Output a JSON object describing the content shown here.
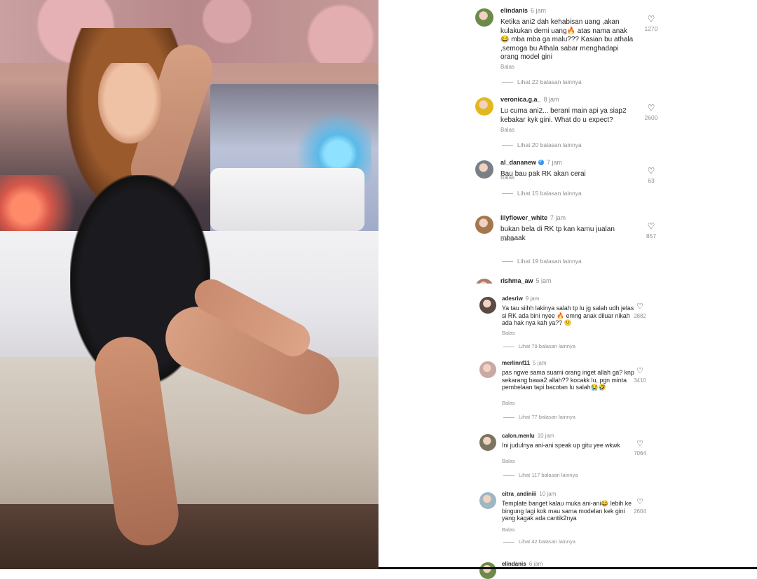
{
  "photo": {
    "alt": ""
  },
  "comments_top": [
    {
      "username": "elindanis",
      "time": "6 jam",
      "verified": false,
      "text": "Ketika ani2 dah kehabisan uang ,akan kulakukan demi uang🔥 atas nama anak 😂 mba mba ga malu??? Kasian bu athala ,semoga bu Athala sabar menghadapi orang model gini",
      "reply": "Balas",
      "likes": "1270",
      "more": "Lihat 22 balasan lainnya",
      "avatar_color": "#6d8a4a"
    },
    {
      "username": "veronica.g.a_",
      "time": "8 jam",
      "verified": false,
      "text": "Lu cuma ani2... berani main api ya siap2 kebakar kyk gini. What do u expect?",
      "reply": "Balas",
      "likes": "2600",
      "more": "Lihat 20 balasan lainnya",
      "avatar_color": "#e2b81f"
    },
    {
      "username": "al_dananew",
      "time": "7 jam",
      "verified": true,
      "text": "Bau bau pak RK akan cerai",
      "reply": "Balas",
      "likes": "63",
      "more": "Lihat 15 balasan lainnya",
      "avatar_color": "#7a7f86"
    },
    {
      "username": "lilyflower_white",
      "time": "7 jam",
      "verified": false,
      "text": "bukan bela di RK tp kan kamu jualan mbaaak",
      "reply": "Balas",
      "likes": "857",
      "more": "Lihat 19 balasan lainnya",
      "avatar_color": "#a4784f"
    },
    {
      "username": "rishma_aw",
      "time": "5 jam",
      "verified": false,
      "text": "",
      "reply": "",
      "likes": "",
      "more": "",
      "avatar_color": "#b07c6a"
    }
  ],
  "comments_bottom": [
    {
      "username": "adesriw",
      "time": "9 jam",
      "text": "Ya tau siihh lakinya salah tp lu jg salah udh jelas si RK ada bini nyee 🔥 emng anak diluar nikah ada hak nya kah ya?? 😕",
      "reply": "Balas",
      "likes": "2882",
      "more": "Lihat 79 balasan lainnya",
      "avatar_color": "#5a4a45"
    },
    {
      "username": "merlinnf11",
      "time": "5 jam",
      "text": "pas ngwe sama suami orang inget allah ga? knp sekarang bawa2 allah?? kocakk lu, pgn minta pembelaan tapi bacotan lu salah😭🤣",
      "reply": "Balas",
      "likes": "3410",
      "more": "Lihat 77 balasan lainnya",
      "avatar_color": "#c9a9a4"
    },
    {
      "username": "calon.menlu",
      "time": "10 jam",
      "text": "Ini judulnya ani-ani speak up gitu yee wkwk",
      "reply": "Balas",
      "likes": "7064",
      "more": "Lihat 117 balasan lainnya",
      "avatar_color": "#7b7460"
    },
    {
      "username": "citra_andiniii",
      "time": "10 jam",
      "text": "Template banget kalau muka ani-ani😂 lebih ke bingung lagi kok mau sama modelan kek gini yang kagak ada cantik2nya",
      "reply": "Balas",
      "likes": "2604",
      "more": "Lihat 42 balasan lainnya",
      "avatar_color": "#9fb6c5"
    },
    {
      "username": "elindanis",
      "time": "6 jam",
      "text": "",
      "reply": "",
      "likes": "",
      "more": "",
      "avatar_color": "#6d8a4a"
    }
  ]
}
